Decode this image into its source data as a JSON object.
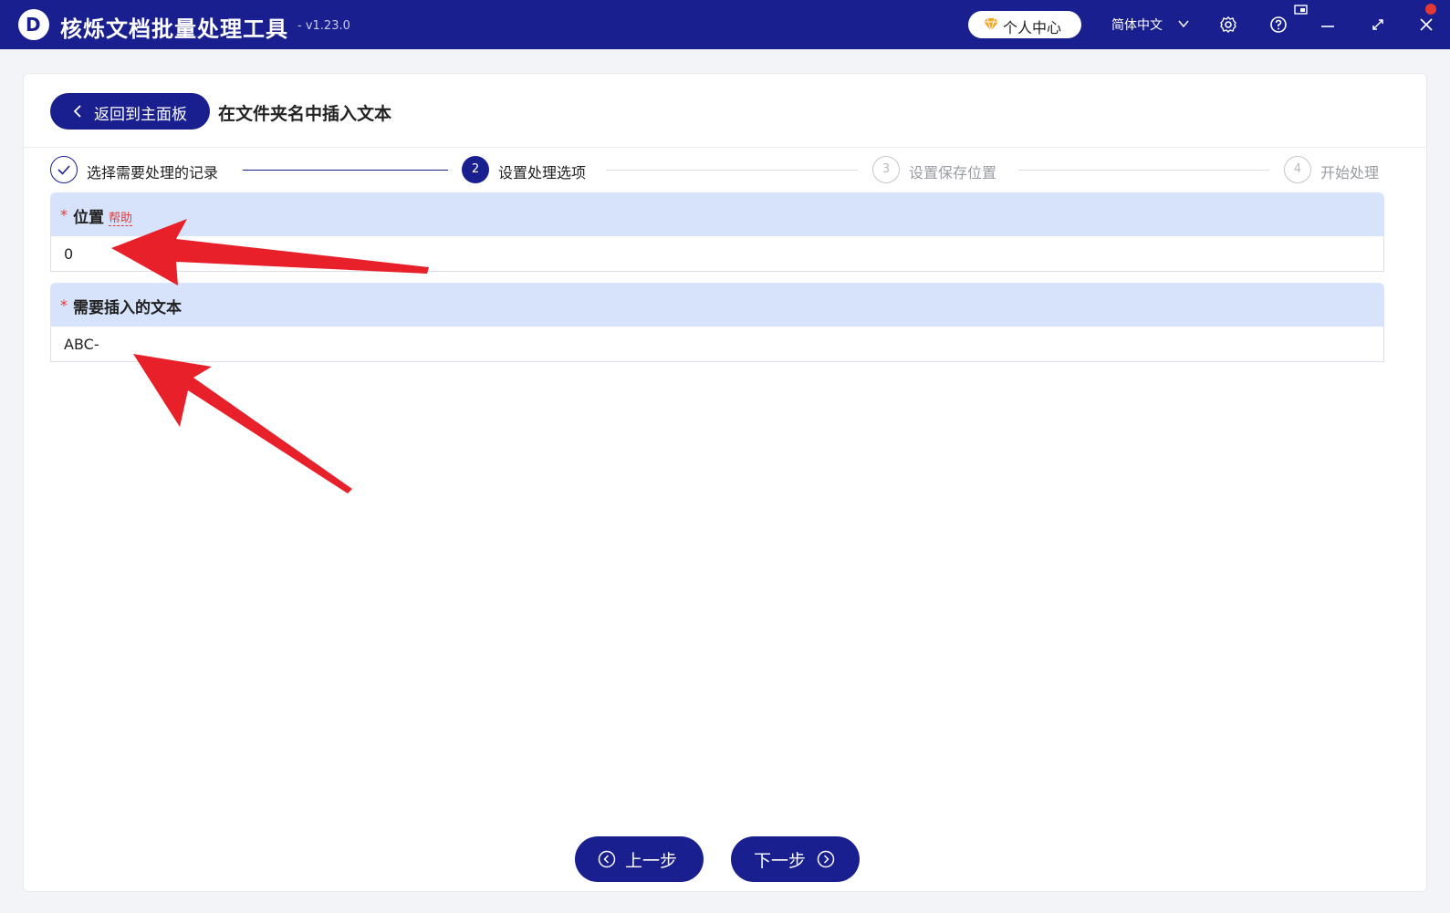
{
  "app": {
    "title": "核烁文档批量处理工具",
    "version": "- v1.23.0",
    "logo_letter": "D"
  },
  "titlebar": {
    "user_center_label": "个人中心",
    "language_label": "简体中文",
    "icons": [
      "gem-icon",
      "chevron-down-icon",
      "gear-icon",
      "help-icon",
      "pin-icon",
      "minimize-icon",
      "maximize-icon",
      "close-icon"
    ]
  },
  "header": {
    "back_button_label": "返回到主面板",
    "page_title": "在文件夹名中插入文本"
  },
  "steps": [
    {
      "number": "1",
      "label": "选择需要处理的记录",
      "state": "done"
    },
    {
      "number": "2",
      "label": "设置处理选项",
      "state": "active"
    },
    {
      "number": "3",
      "label": "设置保存位置",
      "state": "todo"
    },
    {
      "number": "4",
      "label": "开始处理",
      "state": "todo"
    }
  ],
  "form": {
    "required_mark": "*",
    "position": {
      "label": "位置",
      "help_label": "帮助",
      "value": "0"
    },
    "insert_text": {
      "label": "需要插入的文本",
      "value": "ABC-"
    }
  },
  "footer": {
    "prev_label": "上一步",
    "next_label": "下一步"
  },
  "colors": {
    "primary": "#1a1f8f",
    "field_header": "#d6e3fb",
    "required": "#e53935",
    "annotation_arrow": "#e8202a"
  }
}
